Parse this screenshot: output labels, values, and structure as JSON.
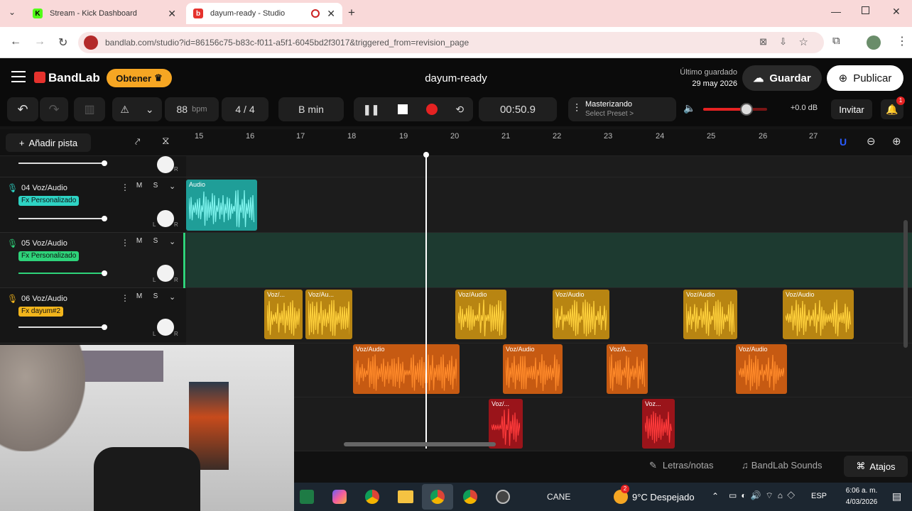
{
  "browser": {
    "tabs": [
      {
        "title": "Stream - Kick Dashboard",
        "icon": "kick-icon"
      },
      {
        "title": "dayum-ready - Studio",
        "icon": "bandlab-icon"
      }
    ],
    "url": "bandlab.com/studio?id=86156c75-b83c-f011-a5f1-6045bd2f3017&triggered_from=revision_page"
  },
  "header": {
    "brand": "BandLab",
    "get_label": "Obtener",
    "project_title": "dayum-ready",
    "last_saved_label": "Último guardado",
    "last_saved_date": "29 may 2026",
    "save_label": "Guardar",
    "publish_label": "Publicar"
  },
  "toolbar": {
    "tempo": "88",
    "tempo_unit": "bpm",
    "time_sig": "4 / 4",
    "key": "B min",
    "time": "00:50.9",
    "mastering_title": "Masterizando",
    "mastering_sub": "Select Preset >",
    "volume_db": "+0.0 dB",
    "volume_level": 0.68,
    "invite_label": "Invitar",
    "notif_count": "1"
  },
  "ruler": {
    "add_track_label": "Añadir pista",
    "marks": [
      "15",
      "16",
      "17",
      "18",
      "19",
      "20",
      "21",
      "22",
      "23",
      "24",
      "25",
      "26",
      "27"
    ]
  },
  "tracks": [
    {
      "num": "04",
      "name": "Voz/Audio",
      "fx": "Fx Personalizado",
      "fx_color": "#2ed3c4"
    },
    {
      "num": "05",
      "name": "Voz/Audio",
      "fx": "Fx Personalizado",
      "fx_color": "#2ed37a"
    },
    {
      "num": "06",
      "name": "Voz/Audio",
      "fx": "Fx dayum#2",
      "fx_color": "#f2b51c"
    }
  ],
  "mute_label": "M",
  "solo_label": "S",
  "pan_left": "L",
  "pan_right": "R",
  "clips": {
    "teal": [
      "Audio"
    ],
    "yellow": [
      "Voz/...",
      "Voz/Au...",
      "Voz/Audio",
      "Voz/Audio",
      "Voz/Audio",
      "Voz/Audio"
    ],
    "orange": [
      "Voz/Audio",
      "Voz/Audio",
      "Voz/A...",
      "Voz/Audio"
    ],
    "red": [
      "Voz/...",
      "Voz..."
    ]
  },
  "bottom": {
    "lyrics_label": "Letras/notas",
    "sounds_label": "BandLab Sounds",
    "shortcuts_label": "Atajos"
  },
  "taskbar": {
    "tray_text": "CANE",
    "weather": "9°C  Despejado",
    "weather_badge": "2",
    "lang": "ESP",
    "clock_time": "6:06 a. m.",
    "clock_date": "4/03/2026"
  },
  "colors": {
    "accent_orange": "#f6a623",
    "teal": "#26c6c0",
    "yellow": "#f2b51c",
    "orange": "#f07a1e",
    "red": "#d8232a"
  }
}
